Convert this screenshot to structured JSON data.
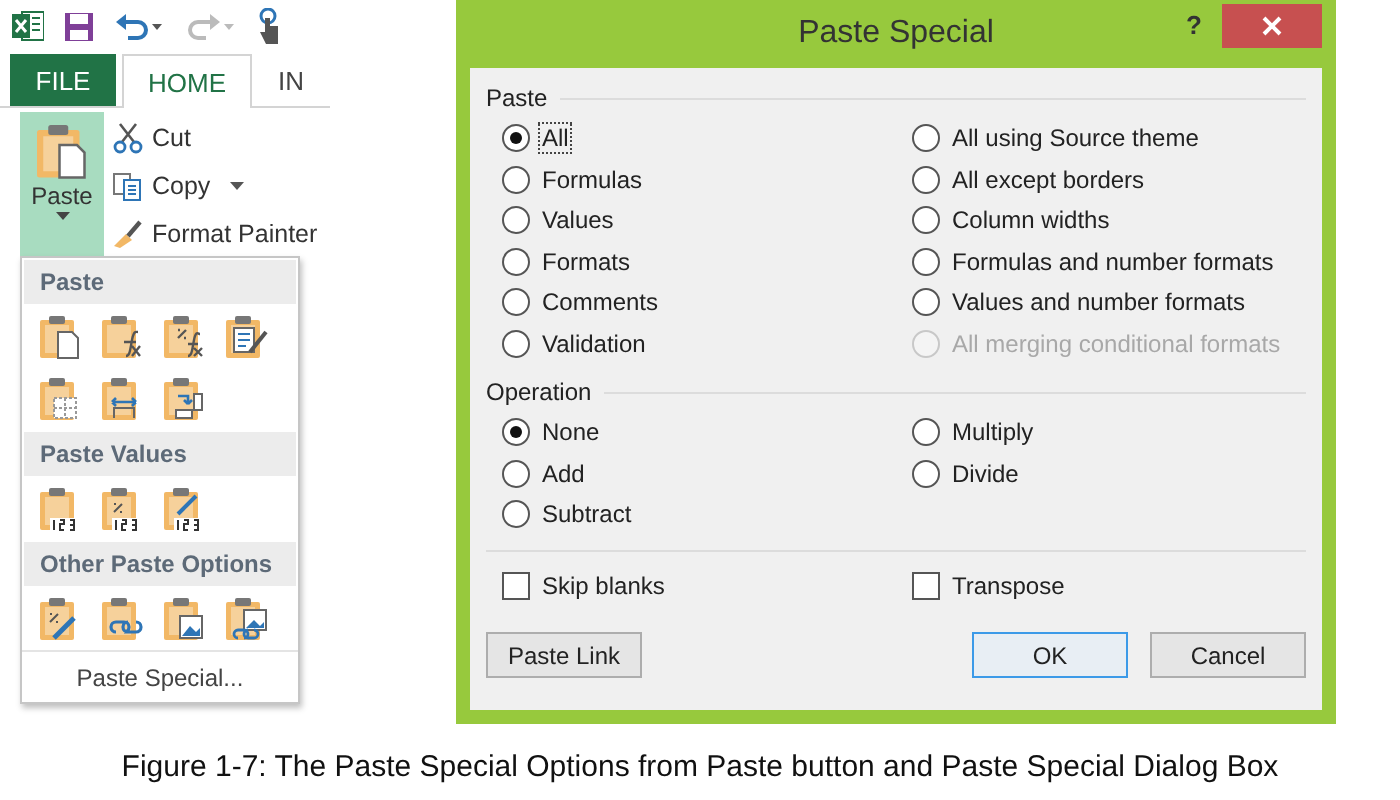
{
  "ribbon": {
    "tabs": [
      {
        "label": "FILE",
        "kind": "file",
        "selected": false
      },
      {
        "label": "HOME",
        "kind": "tab",
        "selected": true
      },
      {
        "label": "IN",
        "kind": "tab",
        "selected": false
      }
    ],
    "paste_button": {
      "label": "Paste",
      "pressed": true
    },
    "commands": [
      {
        "label": "Cut",
        "has_dropdown": false
      },
      {
        "label": "Copy",
        "has_dropdown": true
      },
      {
        "label": "Format Painter",
        "has_dropdown": false
      }
    ]
  },
  "paste_menu": {
    "sections": [
      {
        "header": "Paste"
      },
      {
        "header": "Paste Values"
      },
      {
        "header": "Other Paste Options"
      }
    ],
    "footer": "Paste Special..."
  },
  "dialog": {
    "title": "Paste Special",
    "help": "?",
    "paste": {
      "label": "Paste",
      "options": [
        {
          "label": "All",
          "selected": true,
          "focused": true,
          "disabled": false
        },
        {
          "label": "Formulas",
          "selected": false,
          "focused": false,
          "disabled": false
        },
        {
          "label": "Values",
          "selected": false,
          "focused": false,
          "disabled": false
        },
        {
          "label": "Formats",
          "selected": false,
          "focused": false,
          "disabled": false
        },
        {
          "label": "Comments",
          "selected": false,
          "focused": false,
          "disabled": false
        },
        {
          "label": "Validation",
          "selected": false,
          "focused": false,
          "disabled": false
        },
        {
          "label": "All using Source theme",
          "selected": false,
          "focused": false,
          "disabled": false
        },
        {
          "label": "All except borders",
          "selected": false,
          "focused": false,
          "disabled": false
        },
        {
          "label": "Column widths",
          "selected": false,
          "focused": false,
          "disabled": false
        },
        {
          "label": "Formulas and number formats",
          "selected": false,
          "focused": false,
          "disabled": false
        },
        {
          "label": "Values and number formats",
          "selected": false,
          "focused": false,
          "disabled": false
        },
        {
          "label": "All merging conditional formats",
          "selected": false,
          "focused": false,
          "disabled": true
        }
      ]
    },
    "operation": {
      "label": "Operation",
      "options": [
        {
          "label": "None",
          "selected": true
        },
        {
          "label": "Add",
          "selected": false
        },
        {
          "label": "Subtract",
          "selected": false
        },
        {
          "label": "Multiply",
          "selected": false
        },
        {
          "label": "Divide",
          "selected": false
        }
      ]
    },
    "checkboxes": [
      {
        "label": "Skip blanks",
        "checked": false
      },
      {
        "label": "Transpose",
        "checked": false
      }
    ],
    "buttons": [
      {
        "label": "Paste Link",
        "kind": "left",
        "default": false
      },
      {
        "label": "OK",
        "kind": "right",
        "default": true
      },
      {
        "label": "Cancel",
        "kind": "right",
        "default": false
      }
    ]
  },
  "caption": "Figure 1-7: The Paste Special Options from Paste button and Paste Special Dialog Box"
}
